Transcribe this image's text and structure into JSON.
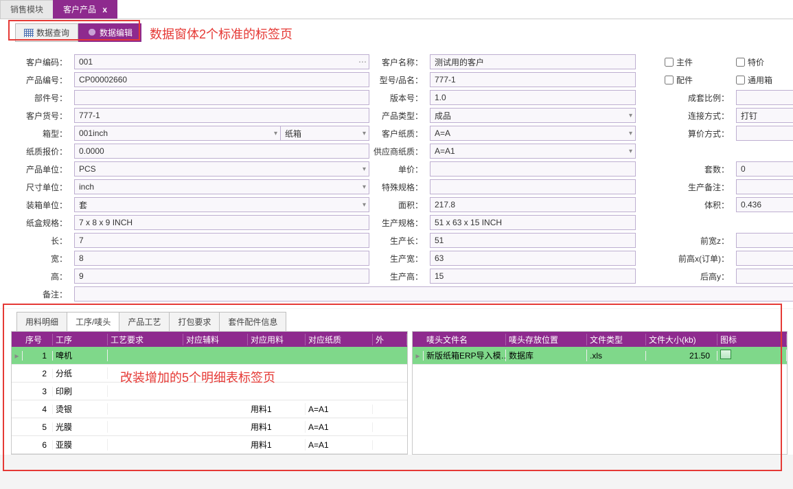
{
  "outer_tabs": {
    "t0": "销售模块",
    "t1": "客户产品",
    "close": "x"
  },
  "inner_tabs": {
    "query": "数据查询",
    "edit": "数据编辑"
  },
  "annotations": {
    "a1": "数据窗体2个标准的标签页",
    "a2": "改装增加的5个明细表标签页"
  },
  "labels": {
    "cust_code": "客户编码：",
    "cust_name": "客户名称：",
    "prod_code": "产品编号：",
    "model": "型号/品名：",
    "part_no": "部件号：",
    "ver": "版本号：",
    "cust_item": "客户货号：",
    "prod_type": "产品类型：",
    "box_type": "箱型：",
    "cust_paper": "客户纸质：",
    "paper_price": "纸质报价：",
    "sup_paper": "供应商纸质：",
    "prod_unit": "产品单位：",
    "unit_price": "单价：",
    "size_unit": "尺寸单位：",
    "spec": "特殊规格：",
    "pack_unit": "装箱单位：",
    "area": "面积：",
    "carton_spec": "纸盒规格：",
    "prod_spec": "生产规格：",
    "len": "长：",
    "plen": "生产长：",
    "wid": "宽：",
    "pwid": "生产宽：",
    "hei": "高：",
    "phei": "生产高：",
    "remark": "备注：",
    "chk_main": "主件",
    "chk_special": "特价",
    "chk_acc": "配件",
    "chk_generic": "通用箱",
    "set_ratio": "成套比例：",
    "conn_way": "连接方式：",
    "calc_way": "算价方式：",
    "set_cnt": "套数：",
    "prod_memo": "生产备注：",
    "volume": "体积：",
    "front_z": "前宽z：",
    "front_x": "前高x(订单)：",
    "back_y": "后高y："
  },
  "values": {
    "cust_code": "001",
    "cust_name": "测试用的客户",
    "prod_code": "CP00002660",
    "model": "777-1",
    "part_no": "",
    "ver": "1.0",
    "cust_item": "777-1",
    "prod_type": "成品",
    "box_type_a": "001inch",
    "box_type_b": "纸箱",
    "cust_paper": "A=A",
    "paper_price": "0.0000",
    "sup_paper": "A=A1",
    "prod_unit": "PCS",
    "unit_price": "",
    "size_unit": "inch",
    "spec": "",
    "pack_unit": "套",
    "area": "217.8",
    "carton_spec": "7 x 8 x 9 INCH",
    "prod_spec": "51 x 63 x 15 INCH",
    "len": "7",
    "plen": "51",
    "wid": "8",
    "pwid": "63",
    "hei": "9",
    "phei": "15",
    "remark": "",
    "set_ratio": "",
    "conn_way": "打钉",
    "calc_way": "",
    "set_cnt": "0",
    "prod_memo": "",
    "volume": "0.436",
    "front_z": "",
    "front_x": "",
    "back_y": ""
  },
  "detail_tabs": [
    "用料明细",
    "工序/唛头",
    "产品工艺",
    "打包要求",
    "套件配件信息"
  ],
  "grid_left": {
    "headers": [
      "序号",
      "工序",
      "工艺要求",
      "对应辅料",
      "对应用料",
      "对应纸质",
      "外"
    ],
    "rows": [
      {
        "n": "1",
        "proc": "啤机",
        "req": "",
        "aux": "",
        "mat": "",
        "paper": "",
        "sel": true
      },
      {
        "n": "2",
        "proc": "分纸",
        "req": "",
        "aux": "",
        "mat": "",
        "paper": ""
      },
      {
        "n": "3",
        "proc": "印刷",
        "req": "",
        "aux": "",
        "mat": "",
        "paper": ""
      },
      {
        "n": "4",
        "proc": "烫银",
        "req": "",
        "aux": "",
        "mat": "用料1",
        "paper": "A=A1"
      },
      {
        "n": "5",
        "proc": "光膜",
        "req": "",
        "aux": "",
        "mat": "用料1",
        "paper": "A=A1"
      },
      {
        "n": "6",
        "proc": "亚膜",
        "req": "",
        "aux": "",
        "mat": "用料1",
        "paper": "A=A1"
      }
    ]
  },
  "grid_right": {
    "headers": [
      "唛头文件名",
      "唛头存放位置",
      "文件类型",
      "文件大小(kb)",
      "图标"
    ],
    "rows": [
      {
        "name": "新版纸箱ERP导入模…",
        "loc": "数据库",
        "type": ".xls",
        "size": "21.50",
        "sel": true
      }
    ]
  }
}
